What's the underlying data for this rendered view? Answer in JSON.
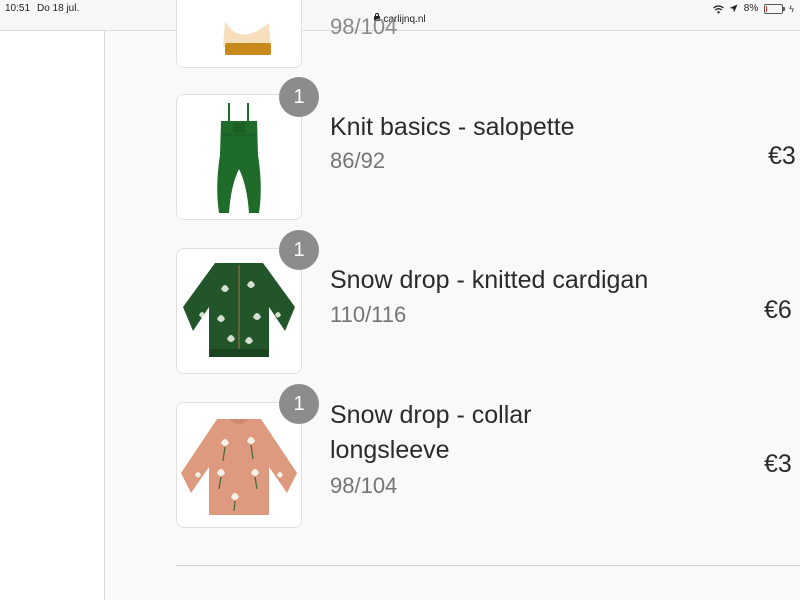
{
  "status_bar": {
    "time": "10:51",
    "date": "Do 18 jul.",
    "url": "carlijnq.nl",
    "battery": "8%",
    "battery_level": 0.08,
    "battery_color": "#e0362a"
  },
  "cart": {
    "partial_size": "98/104",
    "items": [
      {
        "quantity": "1",
        "title_line1": "Knit basics - salopette",
        "title_line2": "",
        "size": "86/92",
        "price": "€3",
        "image": "green-knit-overalls"
      },
      {
        "quantity": "1",
        "title_line1": "Snow drop - knitted cardigan",
        "title_line2": "",
        "size": "110/116",
        "price": "€6",
        "image": "green-snowdrop-cardigan"
      },
      {
        "quantity": "1",
        "title_line1": "Snow drop - collar",
        "title_line2": "longsleeve",
        "size": "98/104",
        "price": "€3",
        "image": "pink-snowdrop-longsleeve"
      }
    ]
  },
  "colors": {
    "badge": "#8c8c8c",
    "overalls": "#1f6b2a",
    "cardigan": "#22552a",
    "longsleeve": "#dd9a7e"
  }
}
